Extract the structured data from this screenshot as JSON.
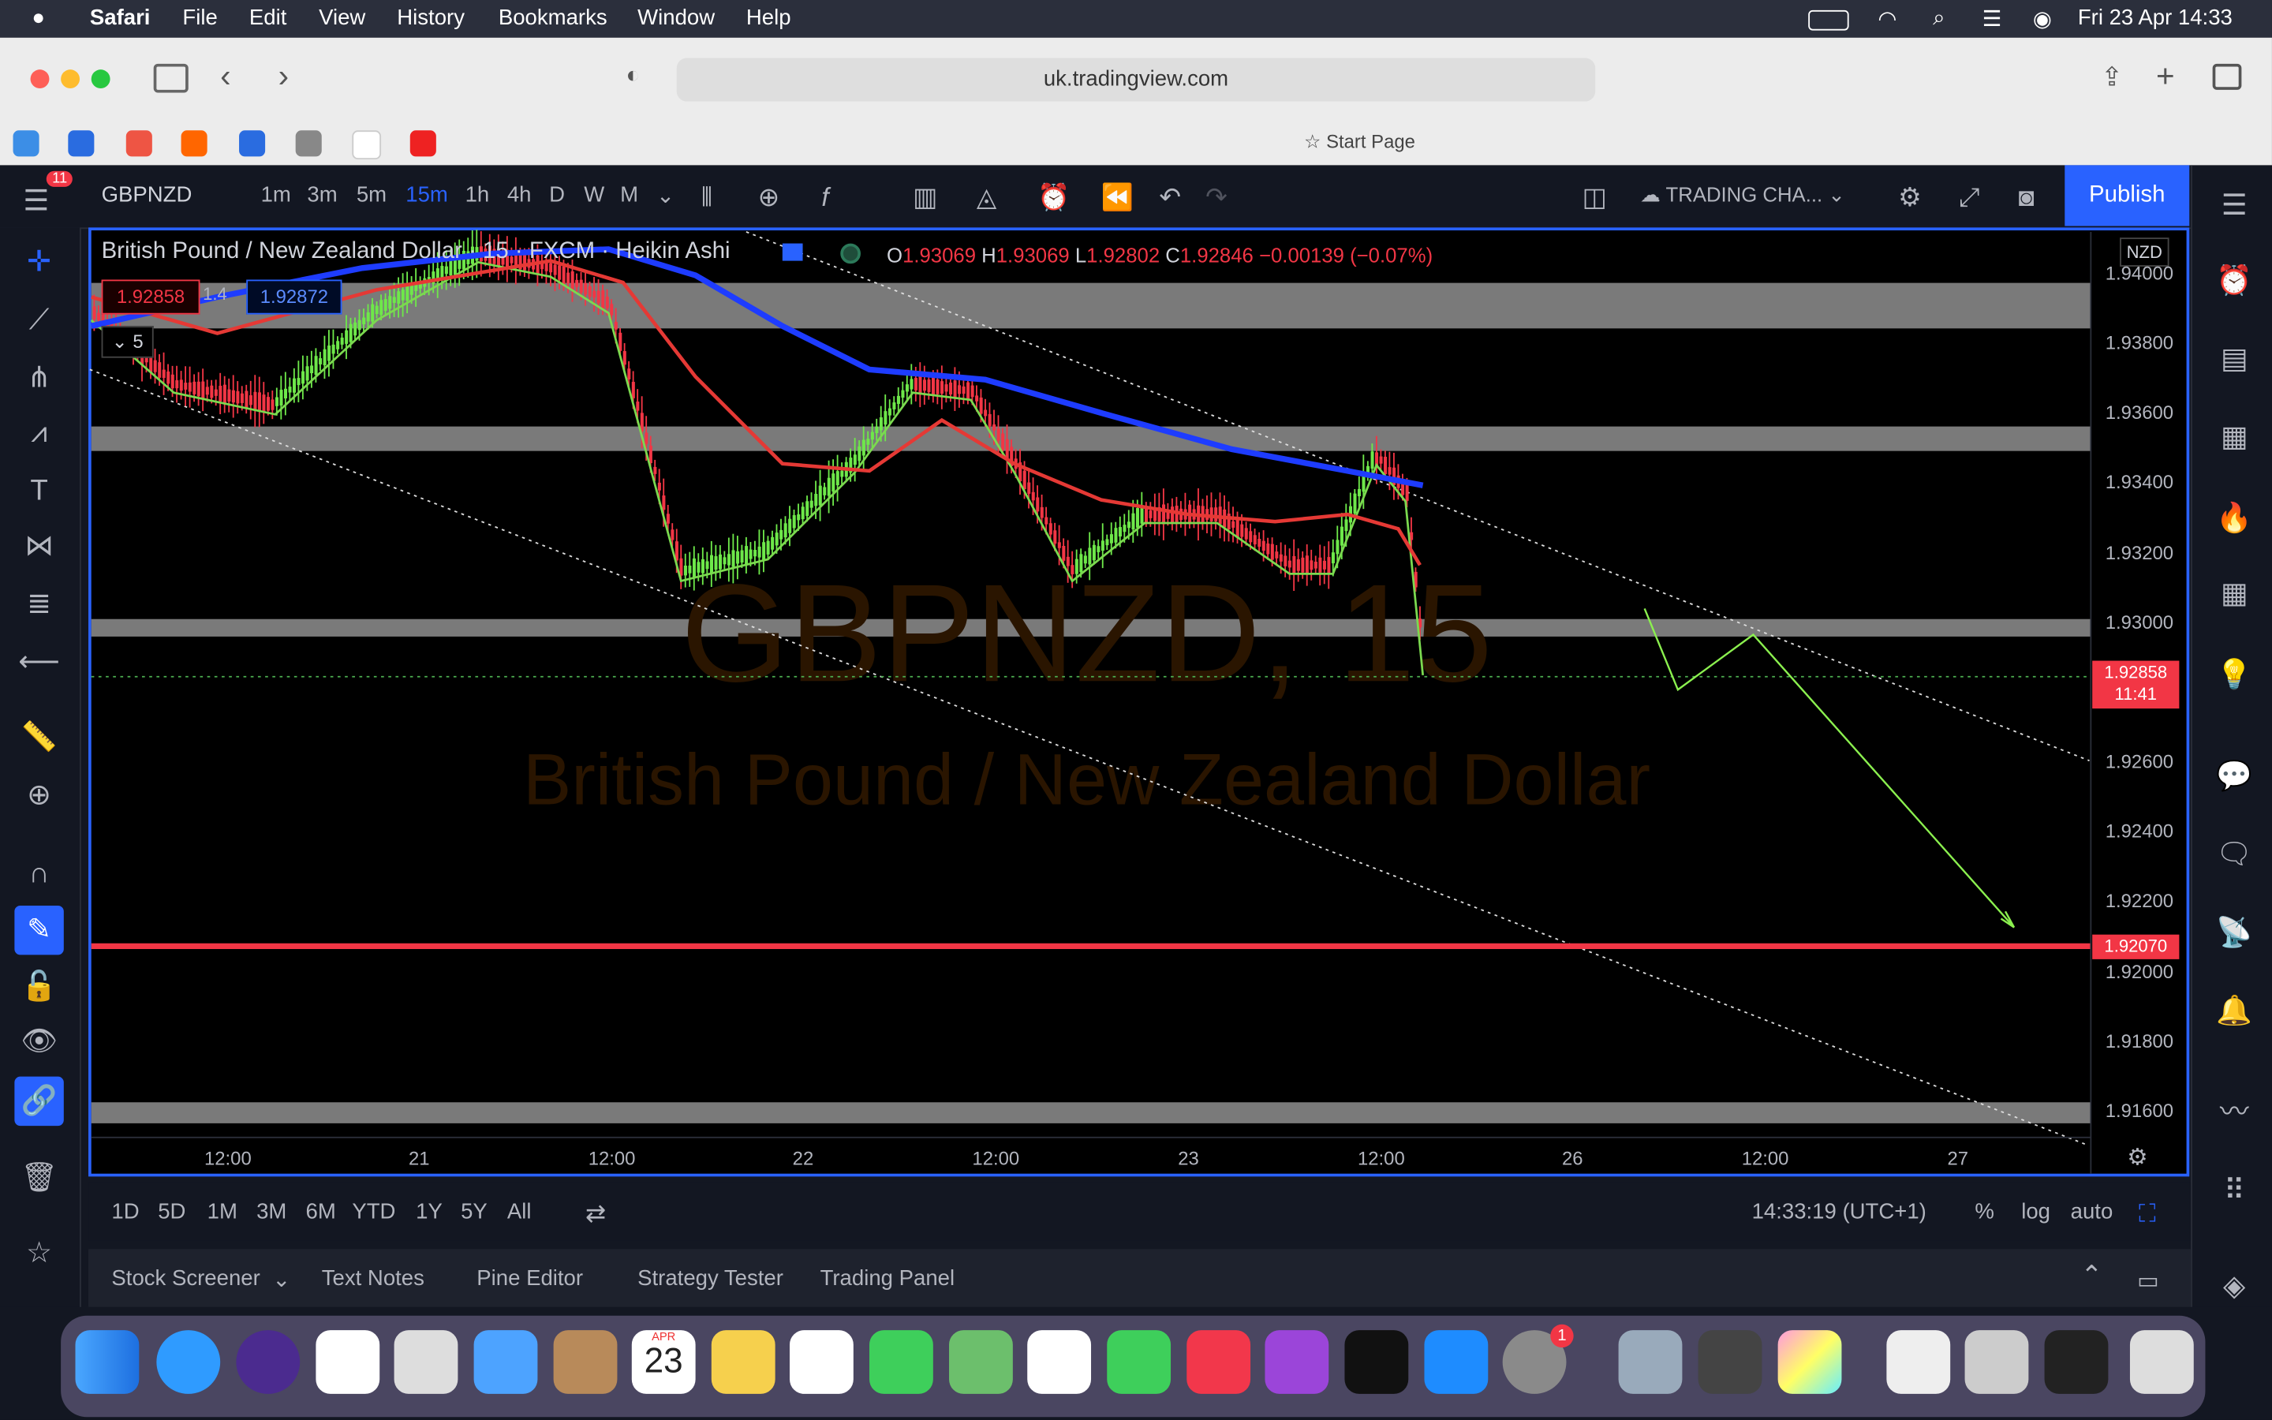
{
  "menubar": {
    "apple": "",
    "app": "Safari",
    "items": [
      "File",
      "Edit",
      "View",
      "History",
      "Bookmarks",
      "Window",
      "Help"
    ],
    "datetime": "Fri 23 Apr  14:33"
  },
  "browser": {
    "url": "uk.tradingview.com",
    "start_page": "Start Page"
  },
  "tv": {
    "badge": "11",
    "symbol": "GBPNZD",
    "intervals": [
      "1m",
      "3m",
      "5m",
      "15m",
      "1h",
      "4h",
      "D",
      "W",
      "M"
    ],
    "active_interval": "15m",
    "layout_name": "TRADING CHA...",
    "publish": "Publish",
    "legend": {
      "title": "British Pound / New Zealand Dollar · 15 · FXCM · Heikin Ashi",
      "o_label": "O",
      "o": "1.93069",
      "h_label": "H",
      "h": "1.93069",
      "l_label": "L",
      "l": "1.92802",
      "c_label": "C",
      "c": "1.92846",
      "chg": "−0.00139 (−0.07%)"
    },
    "bid": "1.92858",
    "spread": "1.4",
    "ask": "1.92872",
    "indicators_count": "5",
    "currency": "NZD",
    "watermark_symbol": "GBPNZD, 15",
    "watermark_name": "British Pound / New Zealand Dollar",
    "price_axis": [
      "1.94000",
      "1.93800",
      "1.93600",
      "1.93400",
      "1.93200",
      "1.93000",
      "1.92600",
      "1.92400",
      "1.92200",
      "1.92000",
      "1.91800",
      "1.91600"
    ],
    "last_price": "1.92858",
    "countdown": "11:41",
    "hline_price": "1.92070",
    "time_axis": [
      "12:00",
      "21",
      "12:00",
      "22",
      "12:00",
      "23",
      "12:00",
      "26",
      "12:00",
      "27"
    ],
    "ranges": [
      "1D",
      "5D",
      "1M",
      "3M",
      "6M",
      "YTD",
      "1Y",
      "5Y",
      "All"
    ],
    "clock": "14:33:19 (UTC+1)",
    "scale_opts": [
      "%",
      "log",
      "auto"
    ],
    "panels": [
      "Stock Screener",
      "Text Notes",
      "Pine Editor",
      "Strategy Tester",
      "Trading Panel"
    ]
  },
  "dock": {
    "calendar_month": "APR",
    "calendar_day": "23",
    "settings_badge": "1"
  },
  "colors": {
    "accent": "#2962ff",
    "bull": "#4caf50",
    "bear": "#f23645",
    "ema_blue": "#1e3cff",
    "band": "#7a7a7a"
  },
  "chart_data": {
    "type": "candlestick",
    "symbol": "GBPNZD",
    "interval": "15",
    "style": "Heikin Ashi",
    "ylim": [
      1.9155,
      1.9408
    ],
    "last_ohlc": {
      "o": 1.93069,
      "h": 1.93069,
      "l": 1.92802,
      "c": 1.92846
    },
    "horizontal_line": 1.9207,
    "zones": [
      [
        1.9384,
        1.9397
      ],
      [
        1.9349,
        1.9356
      ],
      [
        1.9296,
        1.9301
      ],
      [
        1.9157,
        1.9163
      ]
    ]
  }
}
